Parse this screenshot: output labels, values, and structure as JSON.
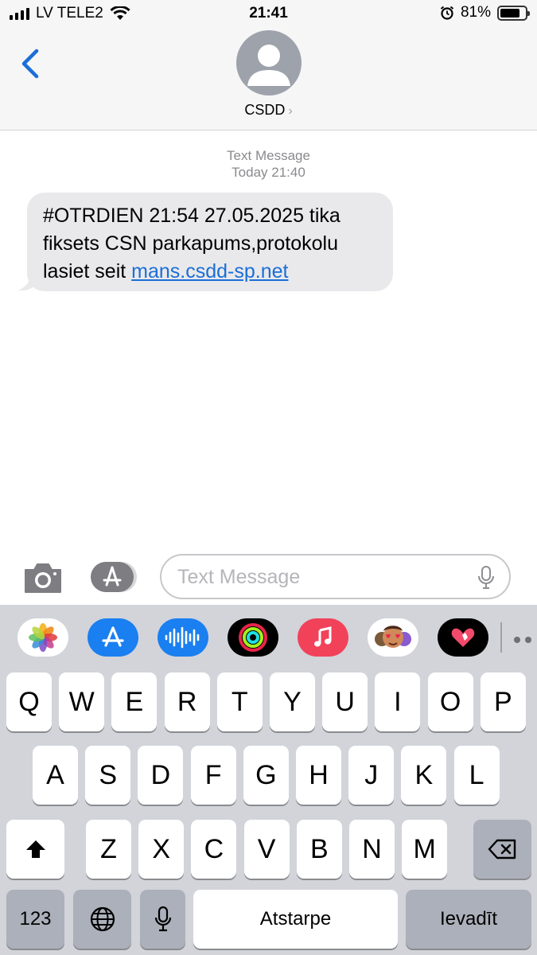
{
  "status_bar": {
    "carrier": "LV TELE2",
    "time": "21:41",
    "battery": "81%",
    "battery_level": 0.81,
    "icons": [
      "signal-icon",
      "wifi-icon",
      "alarm-icon",
      "battery-icon"
    ]
  },
  "header": {
    "contact_name": "CSDD",
    "chevron": "›",
    "icons": [
      "back-chevron-icon",
      "avatar-icon"
    ]
  },
  "conversation": {
    "meta_line1": "Text Message",
    "meta_line2": "Today 21:40",
    "message": {
      "text_line1": "#OTRDIEN 21:54 27.05.2025 tika",
      "text_line2": "fiksets CSN parkapums,protokolu",
      "text_line3_prefix": "lasiet seit",
      "link_text": "mans.csdd-sp.net"
    }
  },
  "input_bar": {
    "placeholder": "Text Message",
    "icons": [
      "camera-icon",
      "app-store-icon",
      "microphone-icon"
    ]
  },
  "app_strip": {
    "apps": [
      "photos-icon",
      "app-store-icon",
      "audio-message-icon",
      "activity-icon",
      "music-icon",
      "memoji-icon",
      "digital-touch-icon",
      "more-icon"
    ]
  },
  "keyboard": {
    "row1": [
      "Q",
      "W",
      "E",
      "R",
      "T",
      "Y",
      "U",
      "I",
      "O",
      "P"
    ],
    "row2": [
      "A",
      "S",
      "D",
      "F",
      "G",
      "H",
      "J",
      "K",
      "L"
    ],
    "row3": [
      "Z",
      "X",
      "C",
      "V",
      "B",
      "N",
      "M"
    ],
    "numbers_key": "123",
    "space_key": "Atstarpe",
    "return_key": "Ievadīt"
  },
  "colors": {
    "accent": "#1a6ed8",
    "bubble": "#e9e9eb",
    "keyboard_bg": "#d2d4da",
    "dark_key": "#abb0ba"
  }
}
